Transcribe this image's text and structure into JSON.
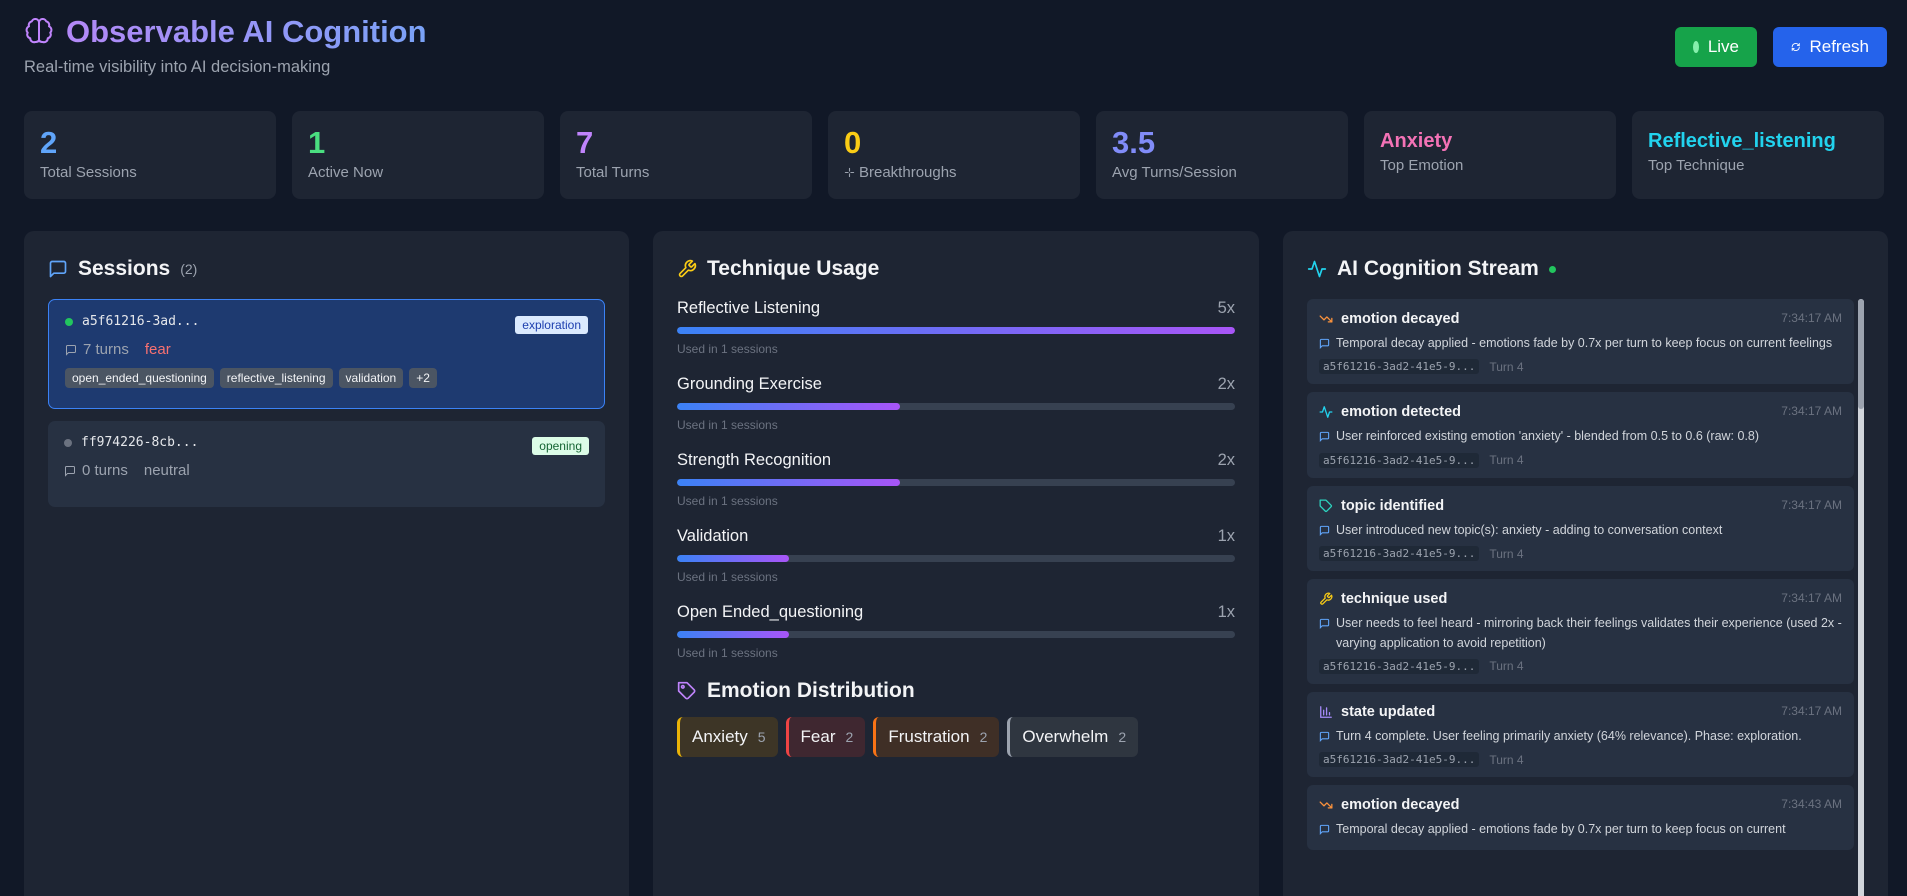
{
  "header": {
    "title": "Observable AI Cognition",
    "subtitle": "Real-time visibility into AI decision-making",
    "live_label": "Live",
    "refresh_label": "Refresh"
  },
  "stats": [
    {
      "value": "2",
      "label": "Total Sessions",
      "color": "#60a5fa"
    },
    {
      "value": "1",
      "label": "Active Now",
      "color": "#4ade80"
    },
    {
      "value": "7",
      "label": "Total Turns",
      "color": "#c084fc"
    },
    {
      "value": "0",
      "label": "Breakthroughs",
      "color": "#facc15"
    },
    {
      "value": "3.5",
      "label": "Avg Turns/Session",
      "color": "#818cf8"
    },
    {
      "value": "Anxiety",
      "label": "Top Emotion",
      "color": "#f472b6"
    },
    {
      "value": "Reflective_listening",
      "label": "Top Technique",
      "color": "#22d3ee"
    }
  ],
  "sessions": {
    "title": "Sessions",
    "count": "(2)",
    "items": [
      {
        "id": "a5f61216-3ad...",
        "phase": "exploration",
        "turns": "7 turns",
        "emotion": "fear",
        "tags": [
          "open_ended_questioning",
          "reflective_listening",
          "validation",
          "+2"
        ]
      },
      {
        "id": "ff974226-8cb...",
        "phase": "opening",
        "turns": "0 turns",
        "emotion": "neutral"
      }
    ]
  },
  "techniques": {
    "title": "Technique Usage",
    "items": [
      {
        "name": "Reflective Listening",
        "count": "5x",
        "fraction": 1.0,
        "sub": "Used in 1 sessions"
      },
      {
        "name": "Grounding Exercise",
        "count": "2x",
        "fraction": 0.4,
        "sub": "Used in 1 sessions"
      },
      {
        "name": "Strength Recognition",
        "count": "2x",
        "fraction": 0.4,
        "sub": "Used in 1 sessions"
      },
      {
        "name": "Validation",
        "count": "1x",
        "fraction": 0.2,
        "sub": "Used in 1 sessions"
      },
      {
        "name": "Open Ended_questioning",
        "count": "1x",
        "fraction": 0.2,
        "sub": "Used in 1 sessions"
      }
    ]
  },
  "emotions": {
    "title": "Emotion Distribution",
    "items": [
      {
        "name": "Anxiety",
        "count": "5"
      },
      {
        "name": "Fear",
        "count": "2"
      },
      {
        "name": "Frustration",
        "count": "2"
      },
      {
        "name": "Overwhelm",
        "count": "2"
      }
    ]
  },
  "stream": {
    "title": "AI Cognition Stream",
    "events": [
      {
        "type": "emotion decayed",
        "icon": "trending-down-icon",
        "time": "7:34:17 AM",
        "text": "Temporal decay applied - emotions fade by 0.7x per turn to keep focus on current feelings",
        "session": "a5f61216-3ad2-41e5-9...",
        "turn": "Turn 4"
      },
      {
        "type": "emotion detected",
        "icon": "activity-icon",
        "time": "7:34:17 AM",
        "text": "User reinforced existing emotion 'anxiety' - blended from 0.5 to 0.6 (raw: 0.8)",
        "session": "a5f61216-3ad2-41e5-9...",
        "turn": "Turn 4"
      },
      {
        "type": "topic identified",
        "icon": "tag-icon",
        "time": "7:34:17 AM",
        "text": "User introduced new topic(s): anxiety - adding to conversation context",
        "session": "a5f61216-3ad2-41e5-9...",
        "turn": "Turn 4"
      },
      {
        "type": "technique used",
        "icon": "wrench-icon",
        "time": "7:34:17 AM",
        "text": "User needs to feel heard - mirroring back their feelings validates their experience (used 2x - varying application to avoid repetition)",
        "session": "a5f61216-3ad2-41e5-9...",
        "turn": "Turn 4"
      },
      {
        "type": "state updated",
        "icon": "bar-chart-icon",
        "time": "7:34:17 AM",
        "text": "Turn 4 complete. User feeling primarily anxiety (64% relevance). Phase: exploration.",
        "session": "a5f61216-3ad2-41e5-9...",
        "turn": "Turn 4"
      },
      {
        "type": "emotion decayed",
        "icon": "trending-down-icon",
        "time": "7:34:43 AM",
        "text": "Temporal decay applied - emotions fade by 0.7x per turn to keep focus on current",
        "session": "",
        "turn": ""
      }
    ]
  }
}
